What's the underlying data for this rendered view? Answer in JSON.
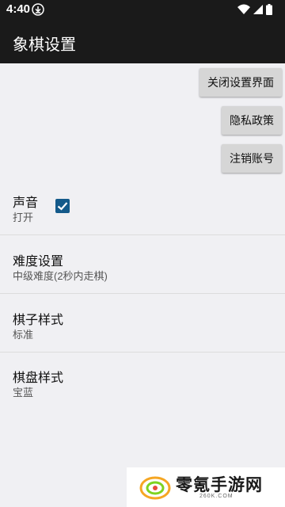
{
  "status_bar": {
    "time": "4:40",
    "icons": [
      "download-icon",
      "wifi-icon",
      "signal-icon",
      "battery-icon"
    ]
  },
  "app_bar": {
    "title": "象棋设置"
  },
  "actions": {
    "close_settings": "关闭设置界面",
    "privacy_policy": "隐私政策",
    "delete_account": "注销账号"
  },
  "preferences": [
    {
      "title": "声音",
      "summary": "打开",
      "checked": true
    },
    {
      "title": "难度设置",
      "summary": "中级难度(2秒内走棋)"
    },
    {
      "title": "棋子样式",
      "summary": "标准"
    },
    {
      "title": "棋盘样式",
      "summary": "宝蓝"
    }
  ],
  "watermark": {
    "title": "零氪手游网",
    "subtitle": "260K.COM"
  },
  "colors": {
    "bar": "#1a1a1a",
    "background": "#f0f0f3",
    "checkbox": "#145a8a",
    "button": "#d6d6d6"
  }
}
